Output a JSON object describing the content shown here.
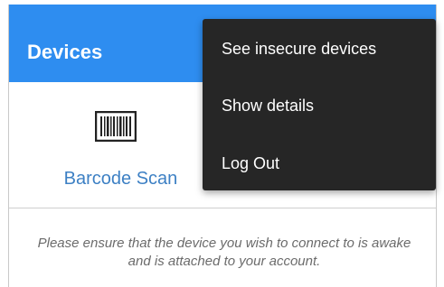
{
  "app_bar": {
    "title": "Devices",
    "color": "#2e8df0"
  },
  "scan_tab": {
    "icon": "barcode-icon",
    "label": "Barcode Scan",
    "label_color": "#3d80c4"
  },
  "hint": {
    "text": "Please ensure that the device you wish to connect to is awake and is attached to your account."
  },
  "menu": {
    "background": "#262626",
    "items": [
      {
        "label": "See insecure devices"
      },
      {
        "label": "Show details"
      },
      {
        "label": "Log Out"
      }
    ]
  }
}
